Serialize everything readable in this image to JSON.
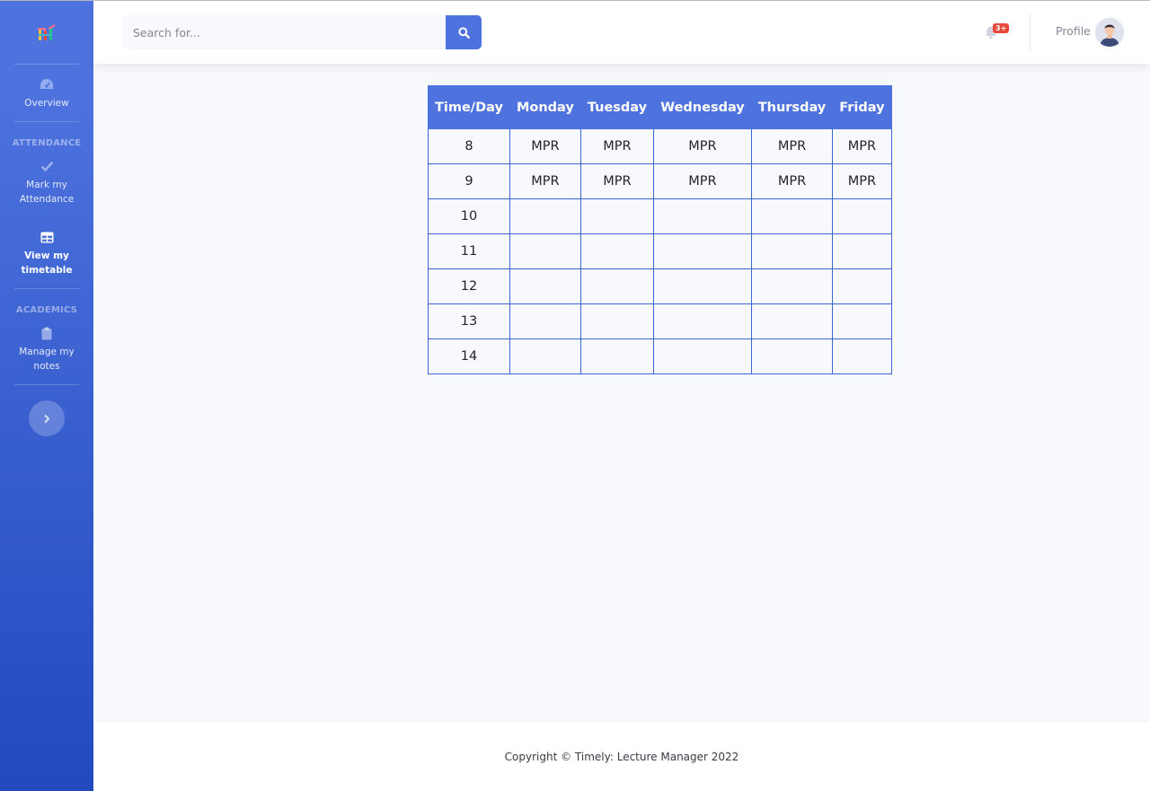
{
  "sidebar": {
    "nav_overview": "Overview",
    "heading_attendance": "ATTENDANCE",
    "nav_mark_attendance": "Mark my Attendance",
    "nav_view_timetable": "View my timetable",
    "heading_academics": "ACADEMICS",
    "nav_manage_notes": "Manage my notes",
    "icons": [
      "logo-icon",
      "dashboard-icon",
      "check-icon",
      "table-icon",
      "clipboard-icon",
      "chevron-right-icon"
    ]
  },
  "topbar": {
    "search_placeholder": "Search for...",
    "notification_badge": "3+",
    "profile_label": "Profile"
  },
  "timetable": {
    "headers": [
      "Time/Day",
      "Monday",
      "Tuesday",
      "Wednesday",
      "Thursday",
      "Friday"
    ],
    "rows": [
      [
        "8",
        "MPR",
        "MPR",
        "MPR",
        "MPR",
        "MPR"
      ],
      [
        "9",
        "MPR",
        "MPR",
        "MPR",
        "MPR",
        "MPR"
      ],
      [
        "10",
        "",
        "",
        "",
        "",
        ""
      ],
      [
        "11",
        "",
        "",
        "",
        "",
        ""
      ],
      [
        "12",
        "",
        "",
        "",
        "",
        ""
      ],
      [
        "13",
        "",
        "",
        "",
        "",
        ""
      ],
      [
        "14",
        "",
        "",
        "",
        "",
        ""
      ]
    ]
  },
  "footer": {
    "copyright": "Copyright © Timely: Lecture Manager 2022"
  },
  "colors": {
    "primary": "#4e73df",
    "sidebar_bottom": "#224abe",
    "badge": "#e74a3b",
    "background": "#f8f9fc"
  }
}
